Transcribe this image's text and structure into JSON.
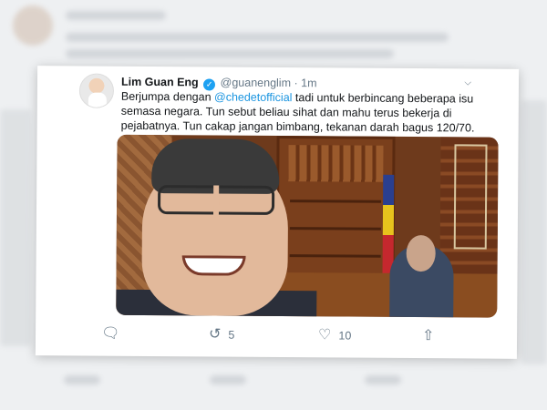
{
  "tweet": {
    "name": "Lim Guan Eng",
    "verified_icon": "verified-check-icon",
    "handle": "@guanenglim",
    "separator": "·",
    "time": "1m",
    "text_before": "Berjumpa dengan ",
    "mention": "@chedetofficial",
    "text_after": " tadi untuk berbincang beberapa isu semasa negara. Tun sebut beliau sihat dan mahu terus bekerja di pejabatnya. Tun cakap jangan bimbang, tekanan darah bagus 120/70.",
    "photo_icon": "tweet-photo"
  },
  "actions": {
    "reply_icon": "reply-icon",
    "retweet_icon": "retweet-icon",
    "retweet_count": "5",
    "like_icon": "heart-icon",
    "like_count": "10",
    "share_icon": "share-icon"
  },
  "colors": {
    "accent": "#1da1f2",
    "mention": "#1b95e0",
    "muted": "#657786"
  }
}
